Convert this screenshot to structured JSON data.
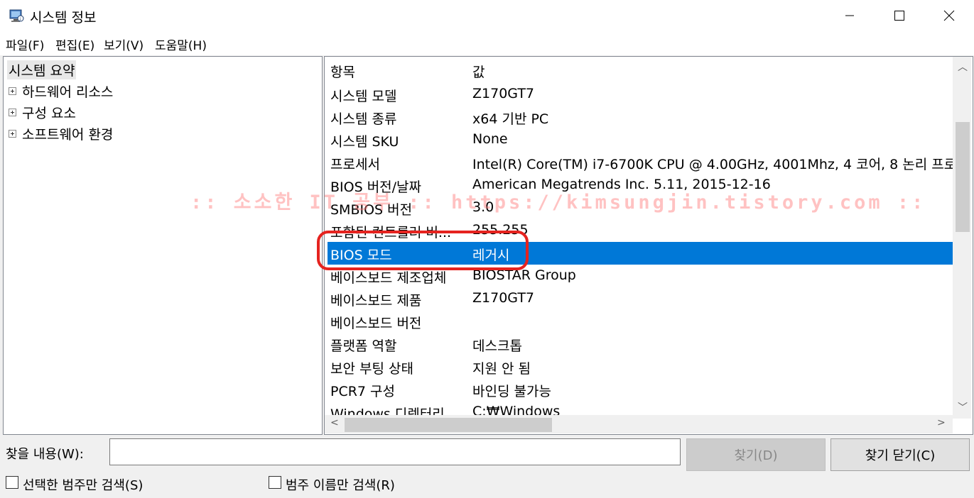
{
  "window": {
    "title": "시스템 정보"
  },
  "menu": [
    "파일(F)",
    "편집(E)",
    "보기(V)",
    "도움말(H)"
  ],
  "tree": {
    "root": "시스템 요약",
    "children": [
      "하드웨어 리소스",
      "구성 요소",
      "소프트웨어 환경"
    ]
  },
  "list": {
    "headers": [
      "항목",
      "값"
    ],
    "rows": [
      [
        "시스템 모델",
        "Z170GT7"
      ],
      [
        "시스템 종류",
        "x64 기반 PC"
      ],
      [
        "시스템 SKU",
        "None"
      ],
      [
        "프로세서",
        "Intel(R) Core(TM) i7-6700K CPU @ 4.00GHz, 4001Mhz, 4 코어, 8 논리 프로"
      ],
      [
        "BIOS 버전/날짜",
        "American Megatrends Inc. 5.11, 2015-12-16"
      ],
      [
        "SMBIOS 버전",
        "3.0"
      ],
      [
        "포함된 컨트롤러 버...",
        "255.255"
      ],
      [
        "BIOS 모드",
        "레거시"
      ],
      [
        "베이스보드 제조업체",
        "BIOSTAR Group"
      ],
      [
        "베이스보드 제품",
        "Z170GT7"
      ],
      [
        "베이스보드 버전",
        ""
      ],
      [
        "플랫폼 역할",
        "데스크톱"
      ],
      [
        "보안 부팅 상태",
        "지원 안 됨"
      ],
      [
        "PCR7 구성",
        "바인딩 불가능"
      ],
      [
        "Windows 디렉터리",
        "C:₩Windows"
      ]
    ],
    "selected_index": 7
  },
  "watermark": ":: 소소한 IT 공부 :: https://kimsungjin.tistory.com ::",
  "find": {
    "label": "찾을 내용(W):",
    "value": "",
    "find_button": "찾기(D)",
    "close_button": "찾기 닫기(C)",
    "cb_selected_only": "선택한 범주만 검색(S)",
    "cb_names_only": "범주 이름만 검색(R)"
  },
  "colors": {
    "selection": "#0078d7",
    "annotation": "#e5231f"
  }
}
